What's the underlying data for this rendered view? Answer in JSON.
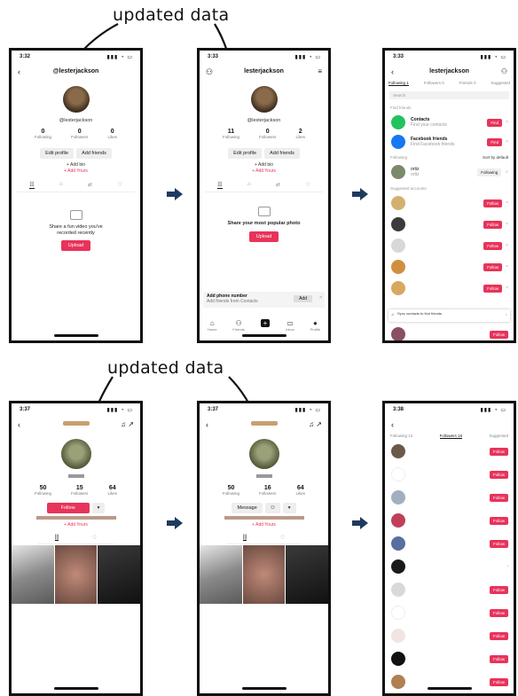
{
  "callouts": {
    "top": "updated data",
    "bottom": "updated data"
  },
  "p1": {
    "time": "3:32",
    "title": "@lesterjackson",
    "username": "@lesterjackson",
    "stats": [
      {
        "n": "0",
        "l": "Following"
      },
      {
        "n": "0",
        "l": "Followers"
      },
      {
        "n": "0",
        "l": "Likes"
      }
    ],
    "btn1": "Edit profile",
    "btn2": "Add friends",
    "bio1": "+ Add bio",
    "bio2": "+ Add Yours",
    "empty1": "Share a fun video you've",
    "empty2": "recorded recently",
    "cta": "Upload"
  },
  "p2": {
    "time": "3:33",
    "title": "lesterjackson",
    "username": "@lesterjackson",
    "stats": [
      {
        "n": "11",
        "l": "Following"
      },
      {
        "n": "0",
        "l": "Followers"
      },
      {
        "n": "2",
        "l": "Likes"
      }
    ],
    "btn1": "Edit profile",
    "btn2": "Add friends",
    "bio1": "+ Add bio",
    "bio2": "+ Add Yours",
    "empty1": "Share your most popular photo",
    "cta": "Upload",
    "banner1": "Add phone number",
    "banner2": "Add friends from Contacts",
    "banner_btn": "Add",
    "nav": [
      "Home",
      "Friends",
      "+",
      "Inbox",
      "Profile"
    ]
  },
  "p3": {
    "time": "3:33",
    "title": "lesterjackson",
    "tabs": [
      "Following 1",
      "Followers 0",
      "Friends 0",
      "Suggested"
    ],
    "search": "Search",
    "section1": "Find friends",
    "friends": [
      {
        "n": "Contacts",
        "s": "Find your contacts",
        "b": "Find",
        "c": "#22c35e"
      },
      {
        "n": "Facebook friends",
        "s": "Find Facebook friends",
        "b": "Find",
        "c": "#1877f2"
      }
    ],
    "section2": "Following",
    "sort": "Sort by default",
    "following": {
      "n": "ortiz",
      "s": "ortiz",
      "b": "Following"
    },
    "section3": "Suggested accounts",
    "suggested": [
      {
        "n": "",
        "s": "",
        "c": "#d4b070"
      },
      {
        "n": "",
        "s": "",
        "c": "#3b3b3b"
      },
      {
        "n": "",
        "s": "",
        "c": "#d8d8d8"
      },
      {
        "n": "",
        "s": "",
        "c": "#d09040"
      },
      {
        "n": "",
        "s": "",
        "c": "#8a5060"
      }
    ],
    "follow": "Follow",
    "notice": "Sync contacts to find friends"
  },
  "p4": {
    "time": "3:37",
    "stats": [
      {
        "n": "50",
        "l": "Following"
      },
      {
        "n": "15",
        "l": "Followers"
      },
      {
        "n": "64",
        "l": "Likes"
      }
    ],
    "btn": "Follow",
    "bio1": "",
    "bio2": "+ Add Yours",
    "tabs": [
      "|||",
      "♡"
    ]
  },
  "p5": {
    "time": "3:37",
    "stats": [
      {
        "n": "50",
        "l": "Following"
      },
      {
        "n": "16",
        "l": "Followers"
      },
      {
        "n": "64",
        "l": "Likes"
      }
    ],
    "btn": "Message",
    "bio1": "",
    "bio2": "+ Add Yours",
    "tabs": [
      "|||",
      "♡"
    ]
  },
  "p6": {
    "time": "3:38",
    "tabs": [
      "Following 12",
      "Followers 16",
      "Suggested"
    ],
    "rows": [
      {
        "n": "",
        "s": "",
        "c": "#6b5a48",
        "b": "Follow"
      },
      {
        "n": "",
        "s": "",
        "c": "#ffffff",
        "b": "Follow"
      },
      {
        "n": "",
        "s": "",
        "c": "#a0b0c0",
        "b": "Follow"
      },
      {
        "n": "",
        "s": "",
        "c": "#c0405a",
        "b": "Follow"
      },
      {
        "n": "",
        "s": "",
        "c": "#5a6fa0",
        "b": "Follow"
      },
      {
        "n": "",
        "s": "",
        "c": "#1a1a1a",
        "b": ""
      },
      {
        "n": "",
        "s": "",
        "c": "#d9d9d9",
        "b": "Follow"
      },
      {
        "n": "",
        "s": "",
        "c": "#ffffff",
        "b": "Follow"
      },
      {
        "n": "",
        "s": "",
        "c": "#f2e4e0",
        "b": "Follow"
      },
      {
        "n": "",
        "s": "",
        "c": "#111111",
        "b": "Follow"
      },
      {
        "n": "",
        "s": "",
        "c": "#b08050",
        "b": "Follow"
      }
    ]
  }
}
